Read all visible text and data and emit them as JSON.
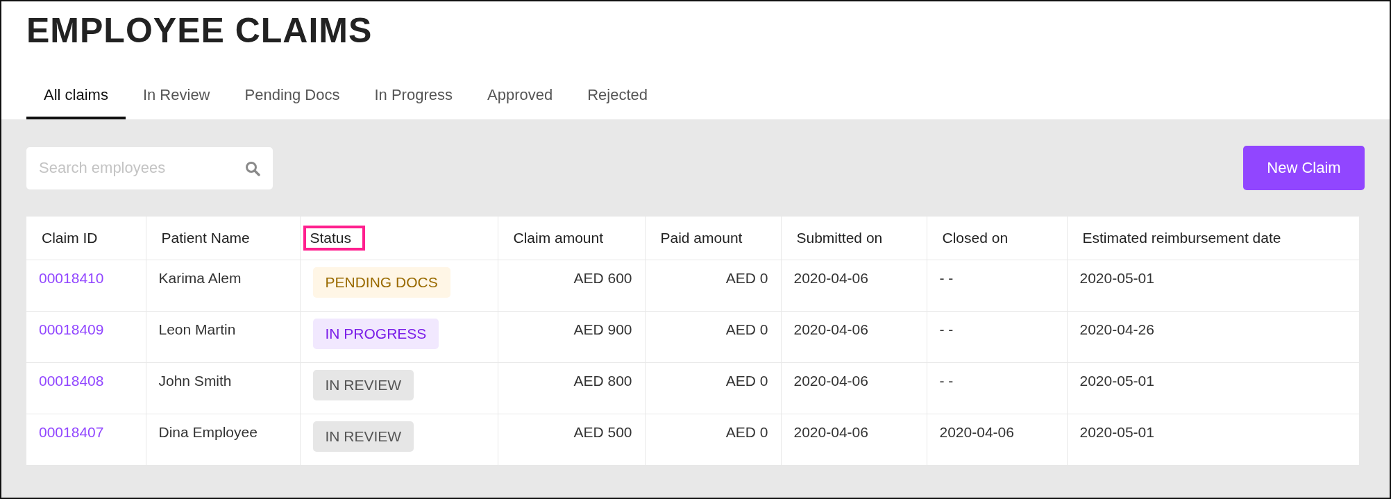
{
  "title": "EMPLOYEE CLAIMS",
  "tabs": [
    {
      "label": "All claims",
      "selected": true
    },
    {
      "label": "In Review",
      "selected": false
    },
    {
      "label": "Pending Docs",
      "selected": false
    },
    {
      "label": "In Progress",
      "selected": false
    },
    {
      "label": "Approved",
      "selected": false
    },
    {
      "label": "Rejected",
      "selected": false
    }
  ],
  "search": {
    "placeholder": "Search employees"
  },
  "new_claim_button": "New Claim",
  "table": {
    "columns": [
      {
        "label": "Claim ID",
        "highlighted": false
      },
      {
        "label": "Patient Name",
        "highlighted": false
      },
      {
        "label": "Status",
        "highlighted": true
      },
      {
        "label": "Claim amount",
        "highlighted": false
      },
      {
        "label": "Paid amount",
        "highlighted": false
      },
      {
        "label": "Submitted on",
        "highlighted": false
      },
      {
        "label": "Closed on",
        "highlighted": false
      },
      {
        "label": "Estimated reimbursement date",
        "highlighted": false
      }
    ],
    "rows": [
      {
        "claim_id": "00018410",
        "patient": "Karima Alem",
        "status": {
          "label": "PENDING DOCS",
          "kind": "pending"
        },
        "claim_amount": "AED 600",
        "paid_amount": "AED 0",
        "submitted": "2020-04-06",
        "closed": "- -",
        "estimated": "2020-05-01"
      },
      {
        "claim_id": "00018409",
        "patient": "Leon Martin",
        "status": {
          "label": "IN PROGRESS",
          "kind": "progress"
        },
        "claim_amount": "AED 900",
        "paid_amount": "AED 0",
        "submitted": "2020-04-06",
        "closed": "- -",
        "estimated": "2020-04-26"
      },
      {
        "claim_id": "00018408",
        "patient": "John Smith",
        "status": {
          "label": "IN REVIEW",
          "kind": "review"
        },
        "claim_amount": "AED 800",
        "paid_amount": "AED 0",
        "submitted": "2020-04-06",
        "closed": "- -",
        "estimated": "2020-05-01"
      },
      {
        "claim_id": "00018407",
        "patient": "Dina Employee",
        "status": {
          "label": "IN REVIEW",
          "kind": "review"
        },
        "claim_amount": "AED 500",
        "paid_amount": "AED 0",
        "submitted": "2020-04-06",
        "closed": "2020-04-06",
        "estimated": "2020-05-01"
      }
    ]
  }
}
